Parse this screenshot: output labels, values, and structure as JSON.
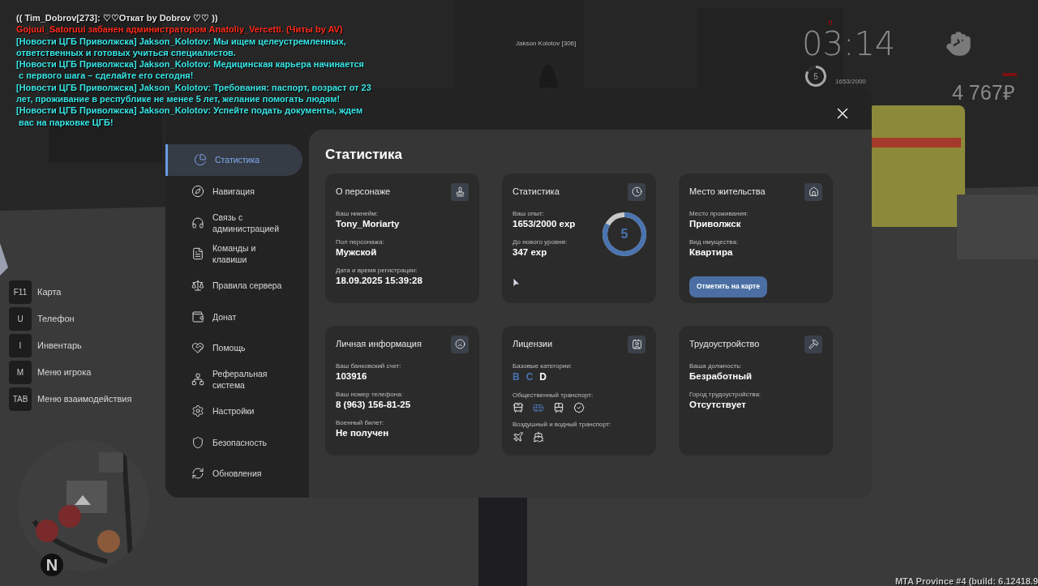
{
  "chat": [
    {
      "text": "(( Tim_Dobrov[273]: ♡♡Откат by Dobrov ♡♡ ))",
      "color": "#e6e6e6"
    },
    {
      "text": "Gojuui_Satoruui забанен администратором Anatoliy_Vercetti. (Читы by AV)",
      "color": "#ff2a1a"
    },
    {
      "text": "[Новости ЦГБ Приволжска] Jakson_Kolotov: Мы ищем целеустремленных,",
      "color": "#38e6e6"
    },
    {
      "text": "ответственных и готовых учиться специалистов.",
      "color": "#38e6e6"
    },
    {
      "text": "[Новости ЦГБ Приволжска] Jakson_Kolotov: Медицинская карьера начинается",
      "color": "#38e6e6"
    },
    {
      "text": " с первого шага – сделайте его сегодня!",
      "color": "#38e6e6"
    },
    {
      "text": "[Новости ЦГБ Приволжска] Jakson_Kolotov: Требования: паспорт, возраст от 23",
      "color": "#38e6e6"
    },
    {
      "text": "лет, проживание в республике не менее 5 лет, желание помогать людям!",
      "color": "#38e6e6"
    },
    {
      "text": "[Новости ЦГБ Приволжска] Jakson_Kolotov: Успейте подать документы, ждем",
      "color": "#38e6e6"
    },
    {
      "text": " вас на парковке ЦГБ!",
      "color": "#38e6e6"
    }
  ],
  "nametag": "Jakson Kolotov [306]",
  "hud": {
    "alert": "!!",
    "time": "03:14",
    "level": "5",
    "level_ring": {
      "level": 0.83
    },
    "exp": "1653/2000",
    "money": "4 767₽"
  },
  "keybinds": [
    {
      "key": "F11",
      "label": "Карта"
    },
    {
      "key": "U",
      "label": "Телефон"
    },
    {
      "key": "I",
      "label": "Инвентарь"
    },
    {
      "key": "M",
      "label": "Меню игрока"
    },
    {
      "key": "TAB",
      "label": "Меню взаимодействия"
    }
  ],
  "minimap": {
    "compass": "N"
  },
  "menu": {
    "sidebar": {
      "items": [
        {
          "label": "Статистика",
          "selected": true
        },
        {
          "label": "Навигация",
          "selected": false
        },
        {
          "label": "Связь с администрацией",
          "selected": false
        },
        {
          "label": "Команды и клавиши",
          "selected": false
        },
        {
          "label": "Правила сервера",
          "selected": false
        },
        {
          "label": "Донат",
          "selected": false
        },
        {
          "label": "Помощь",
          "selected": false
        },
        {
          "label": "Реферальная система",
          "selected": false
        },
        {
          "label": "Настройки",
          "selected": false
        },
        {
          "label": "Безопасность",
          "selected": false
        },
        {
          "label": "Обновления",
          "selected": false
        }
      ]
    },
    "heading": "Статистика",
    "cards": [
      {
        "title": "О персонаже",
        "fields": [
          {
            "label": "Ваш никнейм:",
            "value": "Tony_Moriarty"
          },
          {
            "label": "Пол персонажа:",
            "value": "Мужской"
          },
          {
            "label": "Дата и время регистрации:",
            "value": "18.09.2025 15:39:28"
          }
        ]
      },
      {
        "title": "Статистика",
        "fields": [
          {
            "label": "Ваш опыт:",
            "value": "1653/2000 exp"
          },
          {
            "label": "До нового уровня:",
            "value": "347 exp"
          }
        ],
        "ring": {
          "text": "5",
          "level": 0.83
        }
      },
      {
        "title": "Место жительства",
        "fields": [
          {
            "label": "Место проживания:",
            "value": "Приволжск"
          },
          {
            "label": "Вид имущества:",
            "value": "Квартира"
          }
        ],
        "button": "Отметить на карте"
      },
      {
        "title": "Личная информация",
        "fields": [
          {
            "label": "Ваш банковский счет:",
            "value": "103916"
          },
          {
            "label": "Ваш номер телефона:",
            "value": "8 (963) 156-81-25"
          },
          {
            "label": "Военный билет:",
            "value": "Не получен"
          }
        ]
      },
      {
        "title": "Лицензии",
        "categories_label": "Базовые категории:",
        "categories": [
          {
            "text": "B",
            "owned": true
          },
          {
            "text": "C",
            "owned": true
          },
          {
            "text": "D",
            "owned": false
          }
        ],
        "groups": [
          {
            "label": "Общественный транспорт:",
            "items": [
              {
                "kind": "trolleybus",
                "owned": false
              },
              {
                "kind": "bus",
                "owned": true
              },
              {
                "kind": "tram",
                "owned": false
              },
              {
                "kind": "badge",
                "owned": false
              }
            ]
          },
          {
            "label": "Воздушный и водный транспорт:",
            "items": [
              {
                "kind": "plane",
                "owned": false
              },
              {
                "kind": "boat",
                "owned": false
              }
            ]
          }
        ]
      },
      {
        "title": "Трудоустройство",
        "fields": [
          {
            "label": "Ваша должность:",
            "value": "Безработный"
          },
          {
            "label": "Город трудоустройства:",
            "value": "Отсутствует"
          }
        ]
      }
    ]
  },
  "build": "MTA Province #4 (build: 6.12418.9"
}
